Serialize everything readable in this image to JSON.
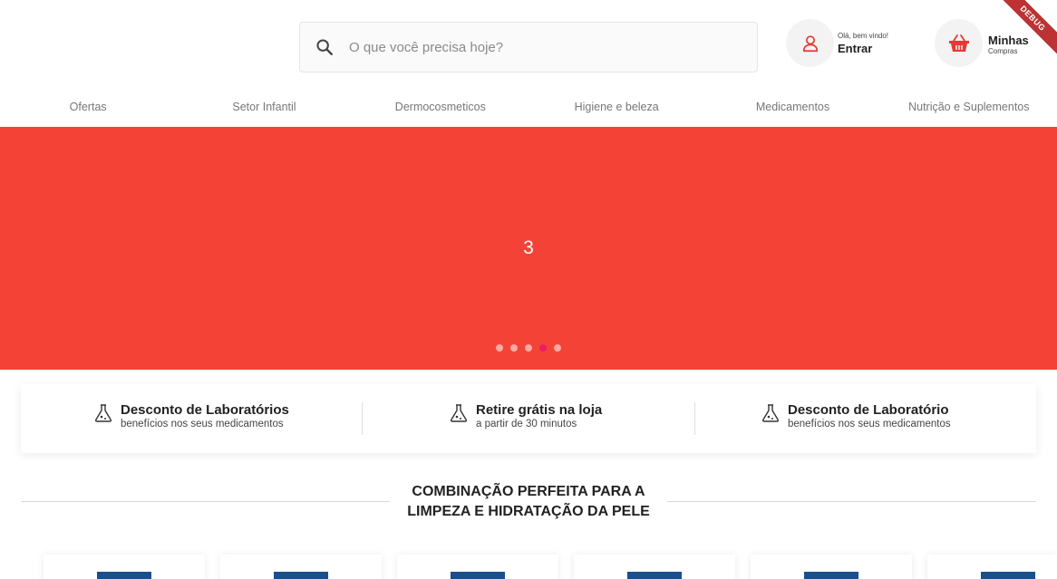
{
  "search": {
    "placeholder": "O que você precisa hoje?"
  },
  "account": {
    "greeting": "Olá, bem vindo!",
    "login_label": "Entrar"
  },
  "cart": {
    "title": "Minhas",
    "subtitle": "Compras"
  },
  "debug_ribbon": "DEBUG",
  "nav": {
    "items": [
      "Ofertas",
      "Setor Infantil",
      "Dermocosmeticos",
      "Higiene e beleza",
      "Medicamentos",
      "Nutrição e Suplementos"
    ]
  },
  "banner": {
    "slide_number": "3",
    "dot_count": 5,
    "active_dot": 4
  },
  "benefits": [
    {
      "title": "Desconto de Laboratórios",
      "subtitle": "benefícios nos seus medicamentos",
      "icon": "flask-icon"
    },
    {
      "title": "Retire grátis na loja",
      "subtitle": "a partir de 30 minutos",
      "icon": "flask-icon"
    },
    {
      "title": "Desconto de Laboratório",
      "subtitle": "benefícios nos seus medicamentos",
      "icon": "flask-icon"
    }
  ],
  "section": {
    "title_line1": "COMBINAÇÃO PERFEITA PARA A",
    "title_line2": "LIMPEZA E HIDRATAÇÃO DA PELE"
  },
  "colors": {
    "banner": "#f44336",
    "accent": "#e53935",
    "active_dot": "#e91e63",
    "product_image": "#1b4f8a"
  }
}
